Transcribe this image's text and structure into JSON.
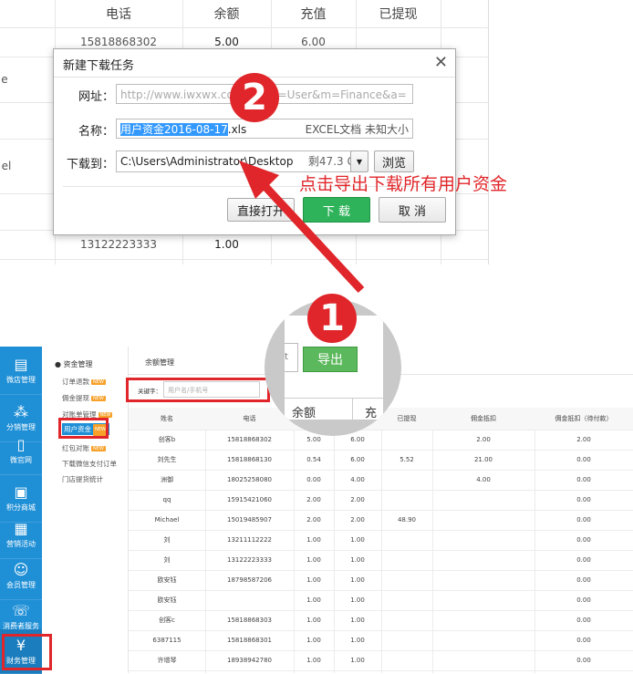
{
  "top_table": {
    "headers": [
      "电话",
      "余额",
      "充值",
      "已提现"
    ],
    "rows": [
      {
        "phone": "15818868302",
        "balance": "5.00",
        "recharge": "6.00"
      },
      {
        "phone": "13122223333",
        "balance": "1.00",
        "recharge": ""
      }
    ],
    "left_fragments": [
      "e",
      "el"
    ]
  },
  "dialog": {
    "title": "新建下载任务",
    "url_label": "网址：",
    "url_value": "http://www.iwxwx.com/...p?g=User&m=Finance&a=",
    "name_label": "名称：",
    "name_selected": "用户资金2016-08-17",
    "name_ext": ".xls",
    "name_type": "EXCEL文档 未知大小",
    "dest_label": "下载到：",
    "dest_value": "C:\\Users\\Administrator\\Desktop",
    "dest_space": "剩47.3 GB",
    "browse_label": "浏览",
    "open_label": "直接打开",
    "download_label": "下 载",
    "cancel_label": "取 消"
  },
  "annotations": {
    "step1": "1",
    "step2": "2",
    "callout": "点击导出下载所有用户资金",
    "accent": "#e0262a"
  },
  "sidebar": {
    "items": [
      {
        "label": "微店管理",
        "icon": "store-icon"
      },
      {
        "label": "分销管理",
        "icon": "network-icon"
      },
      {
        "label": "微官网",
        "icon": "phone-icon"
      },
      {
        "label": "积分商城",
        "icon": "gift-icon"
      },
      {
        "label": "营销活动",
        "icon": "qrcode-icon"
      },
      {
        "label": "会员管理",
        "icon": "users-icon"
      },
      {
        "label": "消费者服务",
        "icon": "headset-icon"
      },
      {
        "label": "财务管理",
        "icon": "yen-icon"
      }
    ]
  },
  "subnav": {
    "heading": "资金管理",
    "items": [
      {
        "label": "订单退款",
        "badge": "NEW"
      },
      {
        "label": "佣金提现",
        "badge": "NEW"
      },
      {
        "label": "对账单管理",
        "badge": "NEW"
      },
      {
        "label": "用户资金",
        "badge": "NEW"
      },
      {
        "label": "红包对账",
        "badge": "NEW"
      },
      {
        "label": "下载微信支付订单",
        "badge": ""
      },
      {
        "label": "门店提货统计",
        "badge": ""
      }
    ]
  },
  "main": {
    "title": "余额管理",
    "search_label": "关键字：",
    "search_placeholder": "用户名/手机号",
    "export_label": "导出",
    "mag_balance": "余额",
    "mag_recharge": "充",
    "mag_fragment": "t",
    "headers": [
      "姓名",
      "电话",
      "",
      "",
      "已提现",
      "佣金抵扣",
      "佣金抵扣（待付款）"
    ],
    "rows": [
      [
        "创客b",
        "15818868302",
        "5.00",
        "6.00",
        "",
        "2.00",
        "2.00"
      ],
      [
        "刘先生",
        "15818868130",
        "0.54",
        "6.00",
        "5.52",
        "21.00",
        "0.00"
      ],
      [
        "洲御",
        "18025258080",
        "0.00",
        "4.00",
        "",
        "4.00",
        "0.00"
      ],
      [
        "qq",
        "15915421060",
        "2.00",
        "2.00",
        "",
        "",
        "0.00"
      ],
      [
        "Michael",
        "15019485907",
        "2.00",
        "2.00",
        "48.90",
        "",
        "0.00"
      ],
      [
        "刘",
        "13211112222",
        "1.00",
        "1.00",
        "",
        "",
        "0.00"
      ],
      [
        "刘",
        "13122223333",
        "1.00",
        "1.00",
        "",
        "",
        "0.00"
      ],
      [
        "欧安钰",
        "18798587206",
        "1.00",
        "1.00",
        "",
        "",
        "0.00"
      ],
      [
        "欧安钰",
        "",
        "1.00",
        "1.00",
        "",
        "",
        "0.00"
      ],
      [
        "创客c",
        "15818868303",
        "1.00",
        "1.00",
        "",
        "",
        "0.00"
      ],
      [
        "6387115",
        "15818868301",
        "1.00",
        "1.00",
        "",
        "",
        "0.00"
      ],
      [
        "许增琴",
        "18938942780",
        "1.00",
        "1.00",
        "",
        "",
        "0.00"
      ]
    ]
  }
}
